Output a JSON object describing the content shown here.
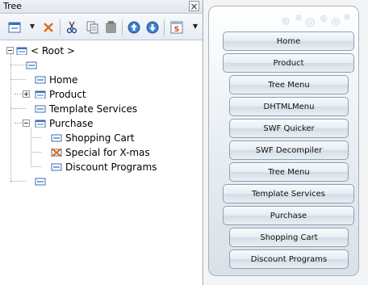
{
  "panel": {
    "title": "Tree",
    "close_glyph": "×"
  },
  "toolbar": {
    "buttons": [
      {
        "name": "add-item",
        "icon": "window-icon"
      },
      {
        "name": "delete",
        "icon": "delete-x-icon"
      },
      {
        "name": "cut",
        "icon": "scissors-icon"
      },
      {
        "name": "copy",
        "icon": "copy-icon"
      },
      {
        "name": "paste",
        "icon": "paste-icon"
      },
      {
        "name": "move-up",
        "icon": "arrow-up-circle-icon"
      },
      {
        "name": "move-down",
        "icon": "arrow-down-circle-icon"
      },
      {
        "name": "style",
        "icon": "style-s-icon",
        "glyph": "S"
      }
    ],
    "dropdown_glyph": "▼"
  },
  "tree": {
    "root_label": "< Root >",
    "nodes": [
      {
        "label": ""
      },
      {
        "label": "Home"
      },
      {
        "label": "Product"
      },
      {
        "label": "Template Services"
      },
      {
        "label": "Purchase"
      },
      {
        "label": "Shopping Cart"
      },
      {
        "label": "Special for X-mas"
      },
      {
        "label": "Discount Programs"
      },
      {
        "label": ""
      }
    ]
  },
  "preview": {
    "menu_items": [
      {
        "label": "Home",
        "level": 0
      },
      {
        "label": "Product",
        "level": 0
      },
      {
        "label": "Tree Menu",
        "level": 1
      },
      {
        "label": "DHTMLMenu",
        "level": 1
      },
      {
        "label": "SWF Quicker",
        "level": 1
      },
      {
        "label": "SWF Decompiler",
        "level": 1
      },
      {
        "label": "Tree Menu",
        "level": 1
      },
      {
        "label": "Template Services",
        "level": 0
      },
      {
        "label": "Purchase",
        "level": 0
      },
      {
        "label": "Shopping Cart",
        "level": 1
      },
      {
        "label": "Discount Programs",
        "level": 1
      }
    ]
  },
  "colors": {
    "accent_blue": "#3a6fb7",
    "delete_orange": "#e06a1a",
    "style_red": "#d23b2a"
  }
}
